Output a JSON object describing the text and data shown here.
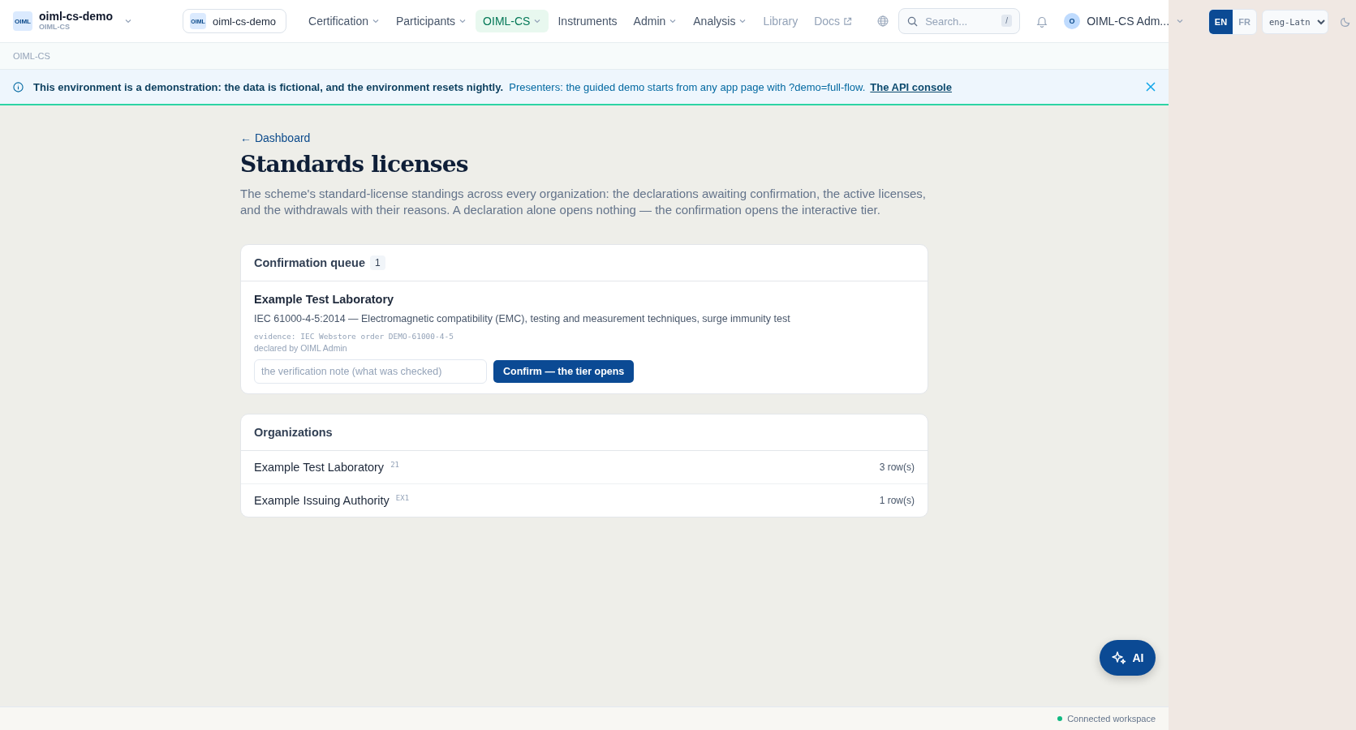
{
  "workspace": {
    "logo": "OIML",
    "name": "oiml-cs-demo",
    "subtitle": "OIML-CS"
  },
  "tenant_chip": {
    "logo": "OIML",
    "label": "oiml-cs-demo"
  },
  "nav": [
    {
      "label": "Certification",
      "selected": false,
      "has_menu": true,
      "dimmed": false,
      "external": false
    },
    {
      "label": "Participants",
      "selected": false,
      "has_menu": true,
      "dimmed": false,
      "external": false
    },
    {
      "label": "OIML-CS",
      "selected": true,
      "has_menu": true,
      "dimmed": false,
      "external": false
    },
    {
      "label": "Instruments",
      "selected": false,
      "has_menu": false,
      "dimmed": false,
      "external": false
    },
    {
      "label": "Admin",
      "selected": false,
      "has_menu": true,
      "dimmed": false,
      "external": false
    },
    {
      "label": "Analysis",
      "selected": false,
      "has_menu": true,
      "dimmed": false,
      "external": false
    },
    {
      "label": "Library",
      "selected": false,
      "has_menu": false,
      "dimmed": true,
      "external": false
    },
    {
      "label": "Docs",
      "selected": false,
      "has_menu": false,
      "dimmed": true,
      "external": true
    }
  ],
  "search": {
    "placeholder": "Search...",
    "shortcut": "/"
  },
  "user": {
    "initial": "O",
    "name": "OIML-CS Adm..."
  },
  "languages": [
    {
      "label": "EN",
      "selected": true
    },
    {
      "label": "FR",
      "selected": false
    }
  ],
  "script_select": {
    "value": "eng-Latn"
  },
  "breadcrumb": "OIML-CS",
  "banner": {
    "bold": "This environment is a demonstration: the data is fictional, and the environment resets nightly.",
    "text": "Presenters: the guided demo starts from any app page with ?demo=full-flow.",
    "link": "The API console"
  },
  "back_link": "← Dashboard",
  "title": "Standards licenses",
  "description": "The scheme's standard-license standings across every organization: the declarations awaiting confirmation, the active licenses, and the withdrawals with their reasons. A declaration alone opens nothing — the confirmation opens the interactive tier.",
  "queue": {
    "title": "Confirmation queue",
    "count": "1",
    "items": [
      {
        "organization": "Example Test Laboratory",
        "standard": "IEC 61000-4-5:2014 — Electromagnetic compatibility (EMC), testing and measurement techniques, surge immunity test",
        "evidence": "evidence: IEC Webstore order DEMO-61000-4-5",
        "declared_by": "declared by OIML Admin",
        "note_placeholder": "the verification note (what was checked)",
        "confirm_label": "Confirm — the tier opens"
      }
    ]
  },
  "organizations": {
    "title": "Organizations",
    "rows": [
      {
        "name": "Example Test Laboratory",
        "code": "21",
        "count": "3 row(s)"
      },
      {
        "name": "Example Issuing Authority",
        "code": "EX1",
        "count": "1 row(s)"
      }
    ]
  },
  "ai_button": {
    "label": "AI"
  },
  "status": {
    "text": "Connected workspace",
    "connected": true
  }
}
